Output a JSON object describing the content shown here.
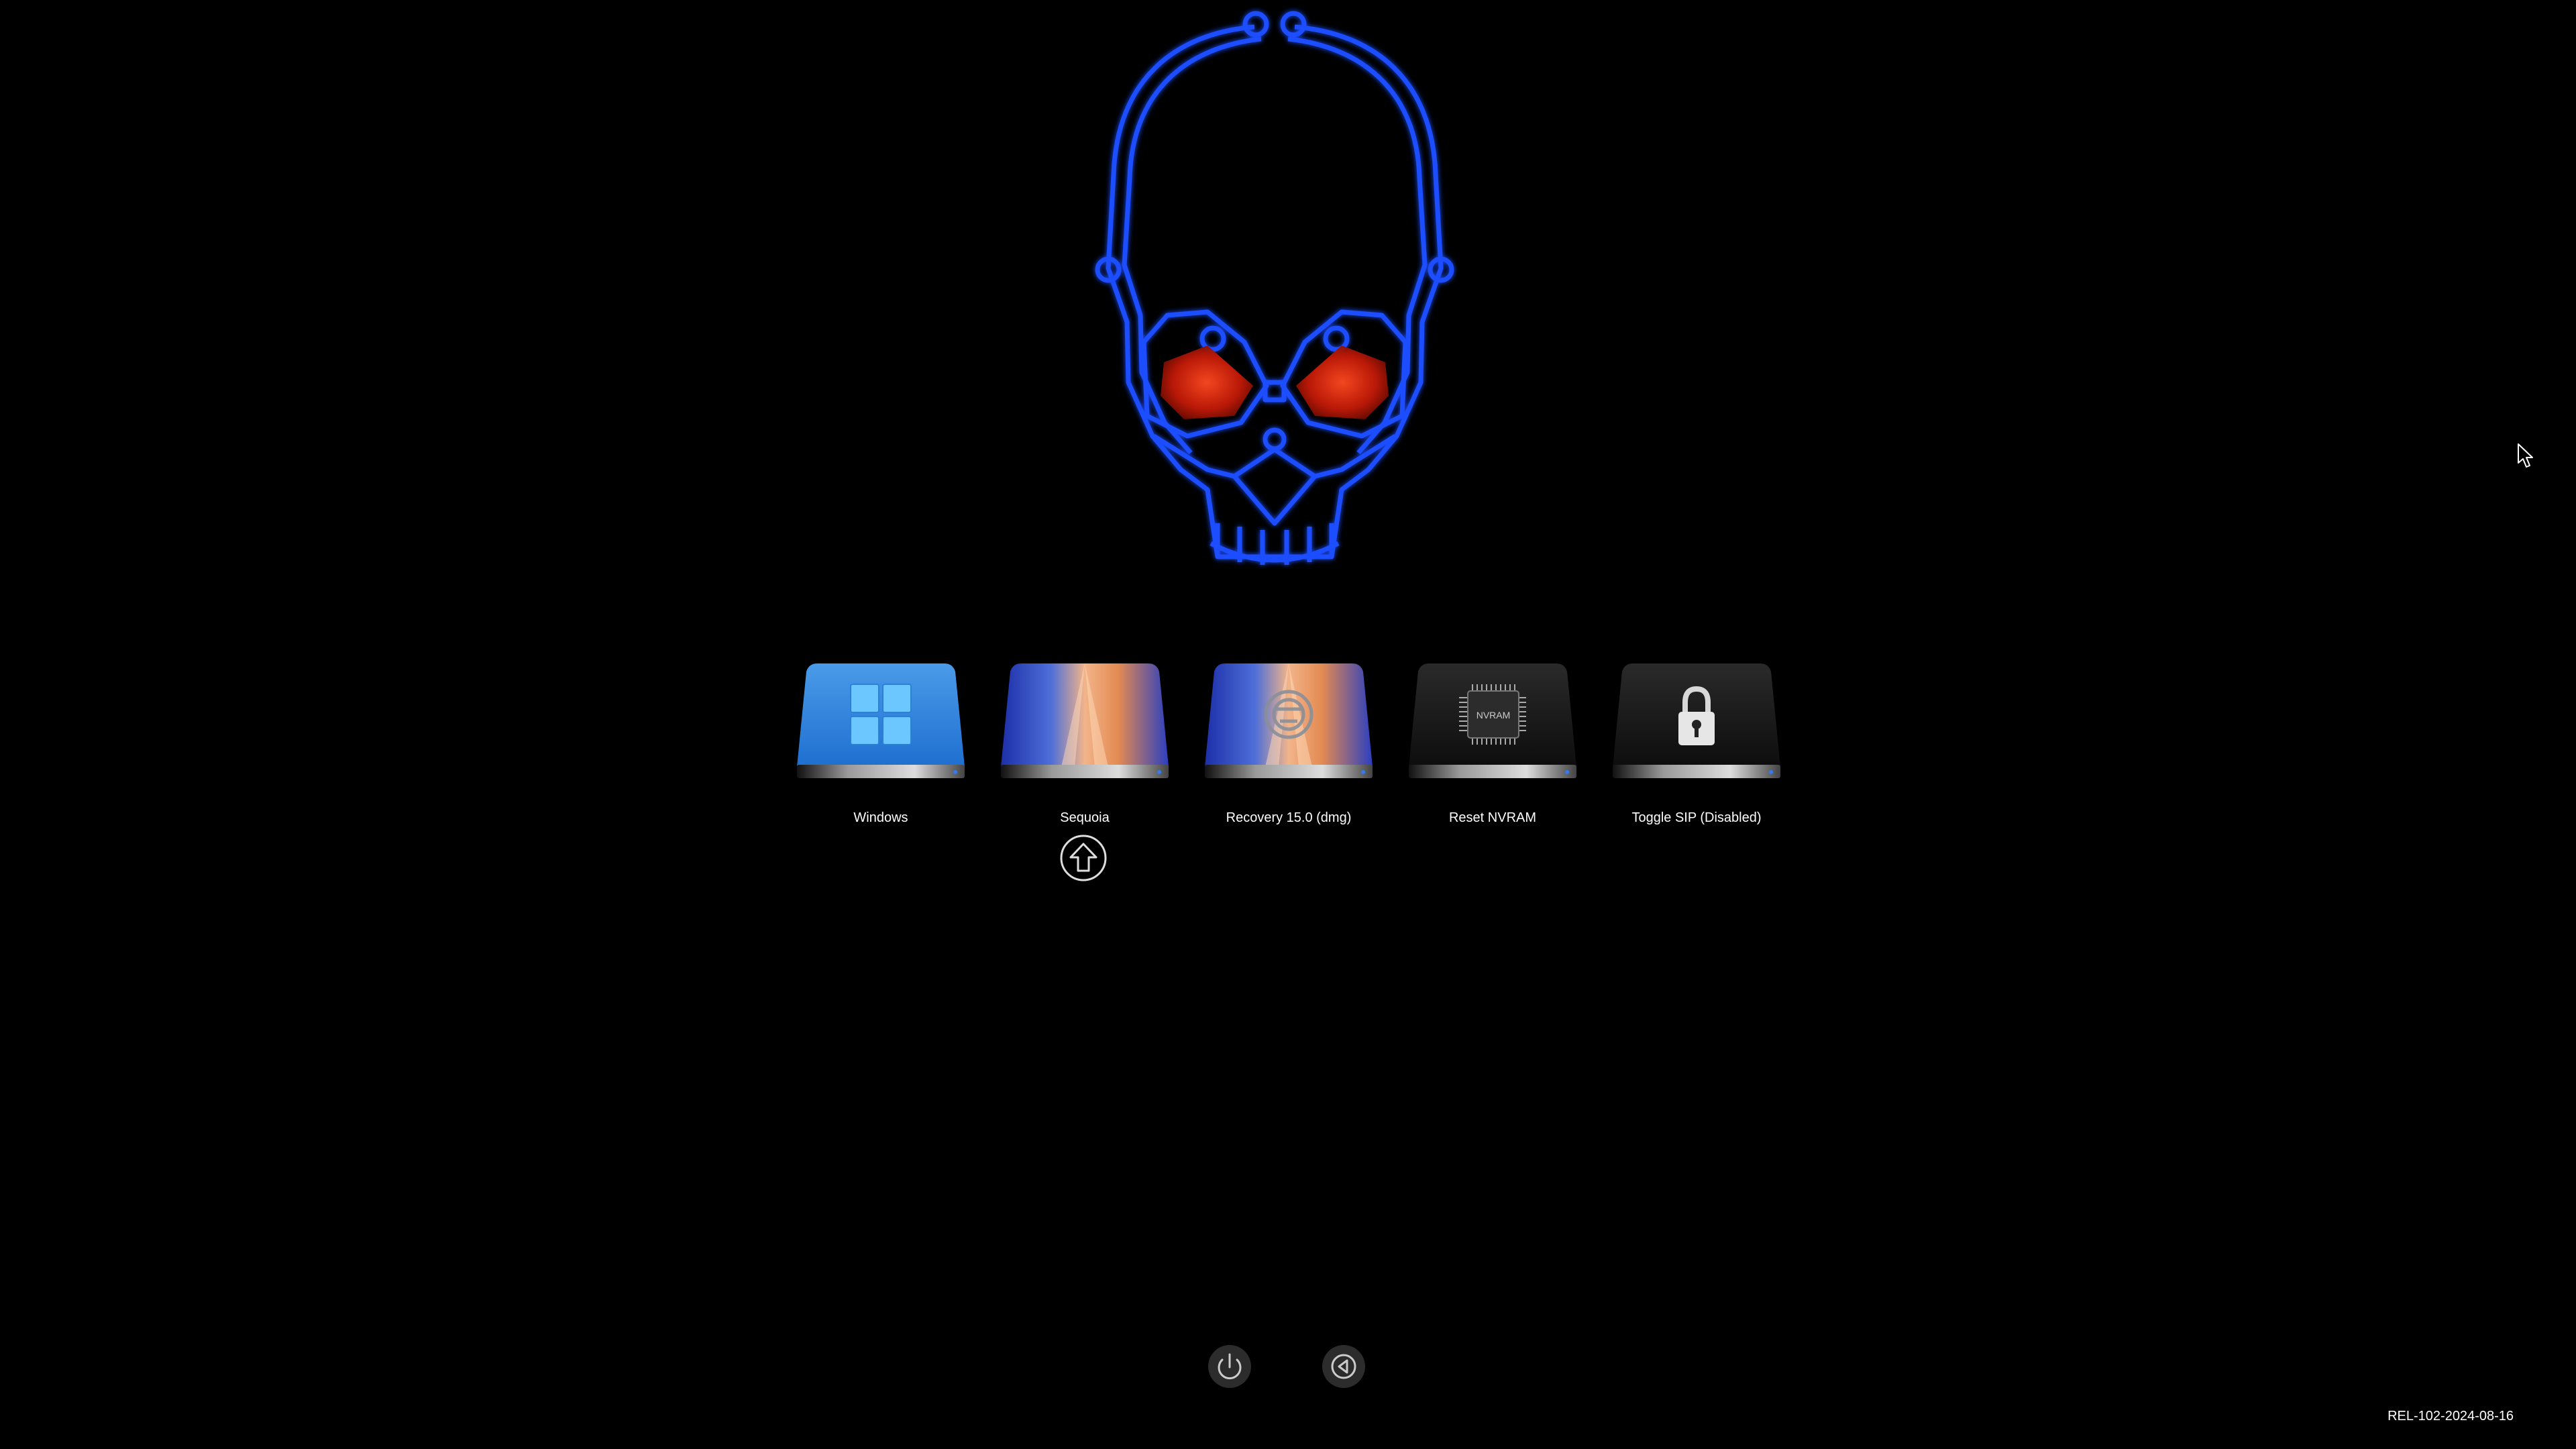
{
  "entries": [
    {
      "id": "windows",
      "label": "Windows",
      "icon": "windows-logo-icon"
    },
    {
      "id": "sequoia",
      "label": "Sequoia",
      "icon": "macos-sequoia-icon"
    },
    {
      "id": "recovery",
      "label": "Recovery 15.0 (dmg)",
      "icon": "recovery-icon"
    },
    {
      "id": "nvram",
      "label": "Reset NVRAM",
      "icon": "nvram-chip-icon"
    },
    {
      "id": "sip",
      "label": "Toggle SIP (Disabled)",
      "icon": "padlock-icon"
    }
  ],
  "nvram_chip_text": "NVRAM",
  "selected_entry": "Sequoia",
  "controls": {
    "shutdown_icon": "power-icon",
    "restart_icon": "restart-icon"
  },
  "version": "REL-102-2024-08-16",
  "logo": "neon-skull-logo",
  "colors": {
    "background": "#000000",
    "neon": "#1a4dff",
    "eyes": "#e0200e"
  }
}
